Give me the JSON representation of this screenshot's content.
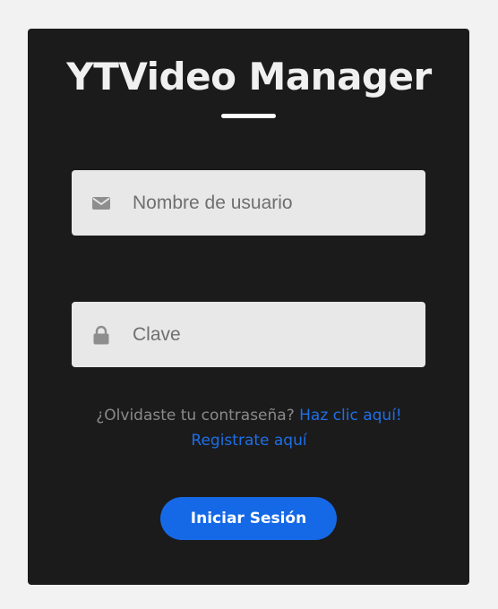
{
  "app": {
    "title": "YTVideo Manager"
  },
  "form": {
    "username": {
      "placeholder": "Nombre de usuario",
      "value": "",
      "icon": "envelope-icon"
    },
    "password": {
      "placeholder": "Clave",
      "value": "",
      "icon": "lock-icon"
    },
    "forgot_text": "¿Olvidaste tu contraseña?",
    "forgot_link": "Haz clic aquí!",
    "register_link": "Registrate aquí",
    "submit_label": "Iniciar Sesión"
  },
  "colors": {
    "card_background": "#1b1b1c",
    "page_background": "#f2f2f2",
    "accent": "#1669e6",
    "link": "#1f6fe6",
    "field_background": "#e8e8e8"
  }
}
